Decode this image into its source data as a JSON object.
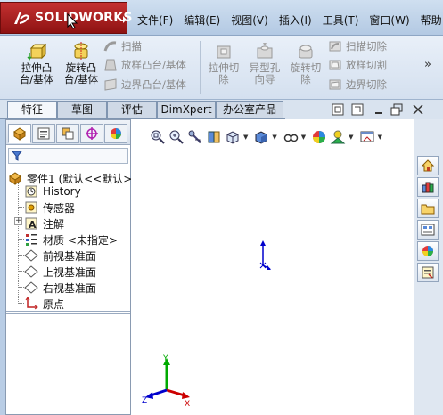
{
  "app": {
    "logo_text": "SOLIDWORKS"
  },
  "menu": {
    "items": [
      "文件(F)",
      "编辑(E)",
      "视图(V)",
      "插入(I)",
      "工具(T)",
      "窗口(W)",
      "帮助"
    ]
  },
  "toolbar": {
    "extrude_boss": "拉伸凸\n台/基体",
    "revolve_boss": "旋转凸\n台/基体",
    "sweep": "扫描",
    "loft_boss": "放样凸台/基体",
    "boundary_boss": "边界凸台/基体",
    "extrude_cut": "拉伸切\n除",
    "hole_wizard": "异型孔\n向导",
    "revolve_cut": "旋转切\n除",
    "swept_cut": "扫描切除",
    "lofted_cut": "放样切割",
    "boundary_cut": "边界切除",
    "more": "»"
  },
  "tabs": [
    "特征",
    "草图",
    "评估",
    "DimXpert",
    "办公室产品"
  ],
  "active_tab": "特征",
  "tree": {
    "part": "零件1 (默认<<默认>",
    "items": [
      "History",
      "传感器",
      "注解",
      "材质 <未指定>",
      "前视基准面",
      "上视基准面",
      "右视基准面",
      "原点"
    ]
  },
  "triad": {
    "x": "X",
    "y": "Y",
    "z": "Z"
  },
  "colors": {
    "accent_red": "#b51f1f",
    "selection_blue": "#0000cc",
    "triad_x": "#cc0000",
    "triad_y": "#00aa00",
    "triad_z": "#0000cc"
  },
  "icons": [
    "house-icon",
    "parts-library-icon",
    "folder-icon",
    "view-palette-icon",
    "appearance-icon",
    "custom-properties-icon"
  ]
}
